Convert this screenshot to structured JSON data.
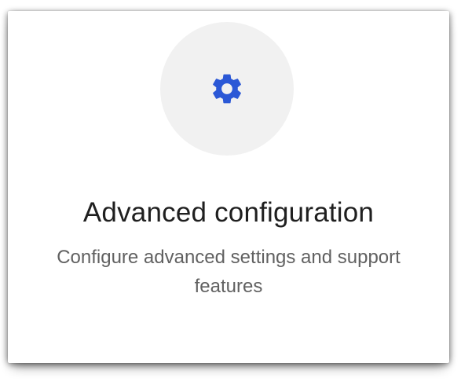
{
  "card": {
    "icon": "gear-icon",
    "icon_color": "#2b58d6",
    "title": "Advanced configuration",
    "description": "Configure advanced settings and support features"
  }
}
